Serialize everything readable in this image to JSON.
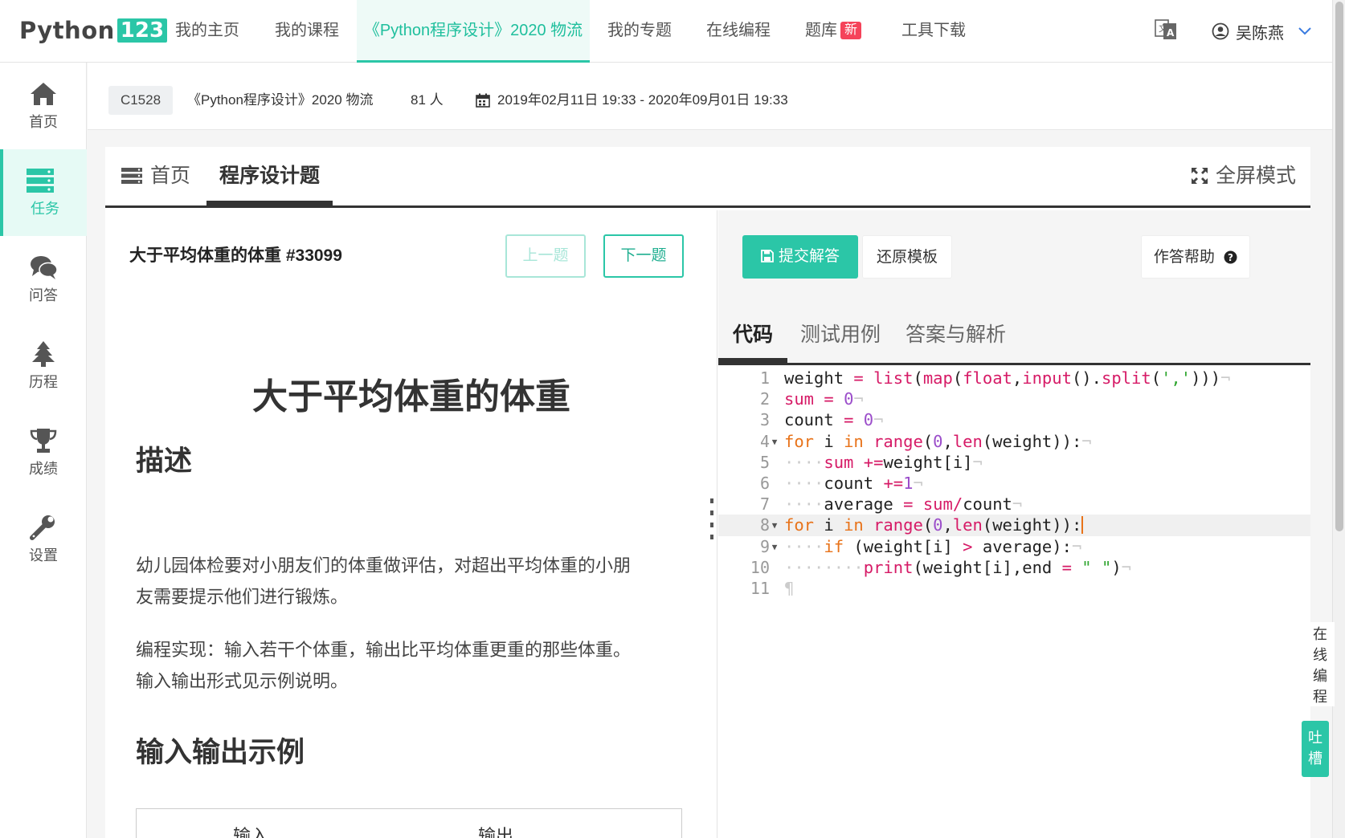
{
  "logo": {
    "text": "Python",
    "num": "123"
  },
  "nav": {
    "home": "我的主页",
    "courses": "我的课程",
    "active_course": "《Python程序设计》2020 物流",
    "topics": "我的专题",
    "online_coding": "在线编程",
    "question_bank": "题库",
    "new_badge": "新",
    "tools": "工具下载"
  },
  "user": {
    "name": "吴陈燕"
  },
  "sidebar": {
    "home": "首页",
    "tasks": "任务",
    "qa": "问答",
    "history": "历程",
    "grades": "成绩",
    "settings": "设置"
  },
  "course_info": {
    "id": "C1528",
    "name": "《Python程序设计》2020 物流",
    "students": "81 人",
    "period": "2019年02月11日 19:33 - 2020年09月01日 19:33"
  },
  "card_tabs": {
    "home": "首页",
    "programming": "程序设计题",
    "fullscreen": "全屏模式"
  },
  "problem": {
    "header_title": "大于平均体重的体重 #33099",
    "prev": "上一题",
    "next": "下一题",
    "title": "大于平均体重的体重",
    "desc_heading": "描述",
    "para1a": "幼儿园体检要对小朋友们的体重做评估，对超出平均体重的小朋",
    "para1b": "友需要提示他们进行锻炼。",
    "para2a": "编程实现：输入若干个体重，输出比平均体重更重的那些体重。",
    "para2b": "输入输出形式见示例说明。",
    "io_heading": "输入输出示例",
    "io_input": "输入",
    "io_output": "输出"
  },
  "toolbar": {
    "submit": "提交解答",
    "restore": "还原模板",
    "help": "作答帮助"
  },
  "editor_tabs": {
    "code": "代码",
    "tests": "测试用例",
    "answer": "答案与解析"
  },
  "code_lines": [
    "weight = list(map(float,input().split(',')))",
    "sum = 0",
    "count = 0",
    "for i in range(0,len(weight)):",
    "    sum +=weight[i]",
    "    count +=1",
    "    average = sum/count",
    "for i in range(0,len(weight)):",
    "    if (weight[i] > average):",
    "        print(weight[i],end = \" \")",
    ""
  ],
  "line_numbers": [
    "1",
    "2",
    "3",
    "4",
    "5",
    "6",
    "7",
    "8",
    "9",
    "10",
    "11"
  ],
  "float": {
    "online_coding": "在线编程",
    "feedback": "吐槽"
  },
  "colors": {
    "accent": "#2bc6a7",
    "keyword": "#e8731a",
    "builtin": "#d61a66",
    "number": "#9b4dca",
    "string": "#2fa52f"
  }
}
